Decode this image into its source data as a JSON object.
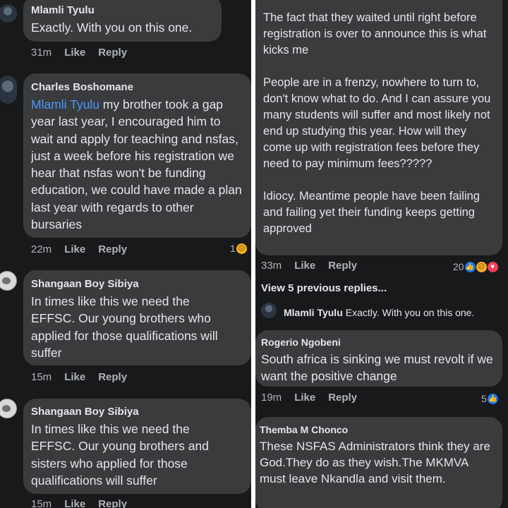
{
  "left": {
    "comments": [
      {
        "author": "Mlamli Tyulu",
        "text": "Exactly. With you on this one.",
        "time": "31m",
        "like": "Like",
        "reply": "Reply"
      },
      {
        "author": "Charles Boshomane",
        "mention": "Mlamli Tyulu",
        "text": " my brother took a gap year last year, I encouraged him to wait and apply for teaching and nsfas, just a week before his registration we hear that nsfas won't be funding education, we could have made a plan last year with regards to other bursaries",
        "time": "22m",
        "like": "Like",
        "reply": "Reply",
        "reaction_count": "1"
      },
      {
        "author": "Shangaan Boy Sibiya",
        "text": "In times like this we need the EFFSC. Our young brothers who applied for those qualifications will suffer",
        "time": "15m",
        "like": "Like",
        "reply": "Reply"
      },
      {
        "author": "Shangaan Boy Sibiya",
        "text": "In times like this we need the EFFSC. Our young brothers and sisters who applied for those qualifications will suffer",
        "time": "15m",
        "like": "Like",
        "reply": "Reply"
      }
    ]
  },
  "right": {
    "top_comment": {
      "text": "The fact that they waited until right before registration is over to announce this is what kicks me\n\nPeople are in a frenzy, nowhere to turn to, don't know what to do. And I can assure you many students will suffer and most likely not end up studying this year. How will they come up with registration fees before  they need to pay minimum fees?????\n\nIdiocy. Meantime people have been failing and failing yet their funding keeps getting approved",
      "time": "33m",
      "like": "Like",
      "reply": "Reply",
      "reaction_count": "20"
    },
    "view_previous": "View 5 previous replies...",
    "reply_preview": {
      "author": "Mlamli Tyulu",
      "text": "Exactly. With you on this one."
    },
    "comments": [
      {
        "author": "Rogerio Ngobeni",
        "text": "South africa is sinking we must revolt if we want the positive change",
        "time": "19m",
        "like": "Like",
        "reply": "Reply",
        "reaction_count": "5"
      },
      {
        "author": "Themba M Chonco",
        "text": "These NSFAS Administrators think they are God.They do as they wish.The MKMVA must leave Nkandla and visit them."
      }
    ]
  },
  "colors": {
    "background": "#18191a",
    "bubble": "#3a3b3c",
    "mention": "#4599ff",
    "meta": "#b0b3b8",
    "divider": "#ffffff"
  },
  "icons": [
    "like-reaction-icon",
    "sad-reaction-icon",
    "love-reaction-icon"
  ]
}
